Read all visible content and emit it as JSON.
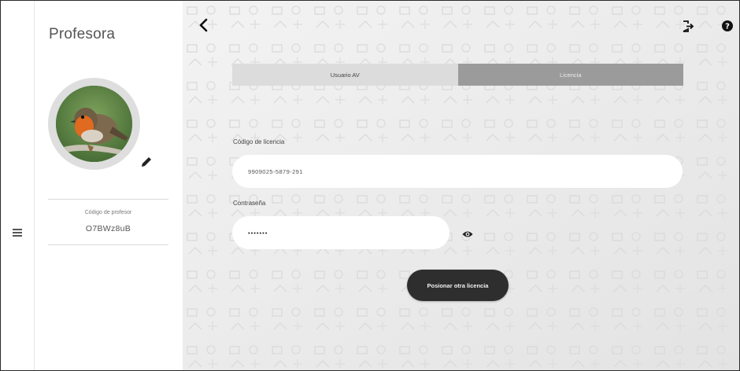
{
  "sidebar": {
    "title": "Profesora",
    "code_label": "Código de profesor",
    "code_value": "O7BWz8uB",
    "menu_icon": "hamburger-menu-icon",
    "edit_icon": "pencil-icon",
    "avatar_alt": "robin-bird-avatar"
  },
  "header": {
    "back_icon": "chevron-left-icon",
    "logout_icon": "logout-icon",
    "help_icon": "help-circle-icon"
  },
  "tabs": [
    {
      "label": "Usuario AV",
      "active": false
    },
    {
      "label": "Licencia",
      "active": true
    }
  ],
  "form": {
    "license_label": "Código de licencia",
    "license_value": "9909025-5879-291",
    "password_label": "Contraseña",
    "password_value": "•••••••",
    "visibility_icon": "eye-icon",
    "submit_label": "Posionar otra licencia"
  },
  "colors": {
    "main_background": "#ebebeb",
    "active_tab": "#9b9b9b",
    "inactive_tab": "#dcdcdc",
    "button": "#2e2e2e"
  }
}
